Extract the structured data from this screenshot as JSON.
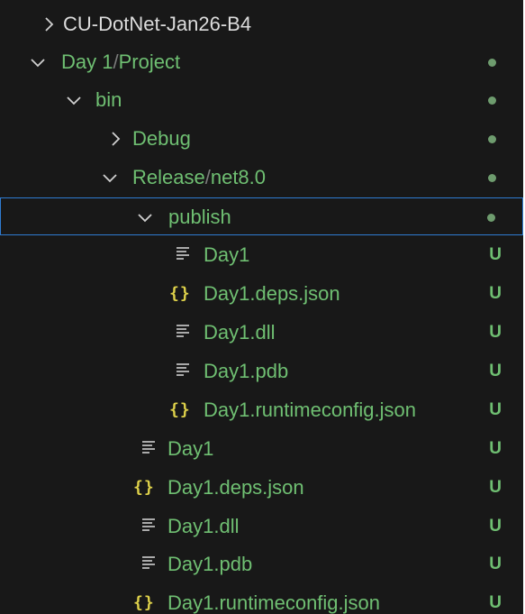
{
  "explorer": {
    "colors": {
      "background": "#181818",
      "green_label": "#6fbf72",
      "white_label": "#dcdcdc",
      "json_icon": "#dfd24a",
      "selection_border": "#2f7bd1"
    },
    "rows": [
      {
        "label": "CU-DotNet-Jan26-B4",
        "kind": "folder",
        "expanded": false,
        "color": "white",
        "status": "",
        "icon": "chevron-right-icon"
      },
      {
        "label_parts": [
          "Day 1",
          "Project"
        ],
        "kind": "folder",
        "expanded": true,
        "color": "green",
        "status": "modified-dot",
        "icon": "chevron-down-icon"
      },
      {
        "label": "bin",
        "kind": "folder",
        "expanded": true,
        "color": "green",
        "status": "modified-dot",
        "icon": "chevron-down-icon"
      },
      {
        "label": "Debug",
        "kind": "folder",
        "expanded": false,
        "color": "green",
        "status": "modified-dot",
        "icon": "chevron-right-icon"
      },
      {
        "label_parts": [
          "Release",
          "net8.0"
        ],
        "kind": "folder",
        "expanded": true,
        "color": "green",
        "status": "modified-dot",
        "icon": "chevron-down-icon"
      },
      {
        "label": "publish",
        "kind": "folder",
        "expanded": true,
        "color": "green",
        "status": "modified-dot",
        "selected": true,
        "icon": "chevron-down-icon"
      },
      {
        "label": "Day1",
        "kind": "file",
        "filetype": "text",
        "color": "green",
        "status": "U",
        "icon": "lines-file-icon"
      },
      {
        "label": "Day1.deps.json",
        "kind": "file",
        "filetype": "json",
        "color": "green",
        "status": "U",
        "icon": "json-braces-icon"
      },
      {
        "label": "Day1.dll",
        "kind": "file",
        "filetype": "text",
        "color": "green",
        "status": "U",
        "icon": "lines-file-icon"
      },
      {
        "label": "Day1.pdb",
        "kind": "file",
        "filetype": "text",
        "color": "green",
        "status": "U",
        "icon": "lines-file-icon"
      },
      {
        "label": "Day1.runtimeconfig.json",
        "kind": "file",
        "filetype": "json",
        "color": "green",
        "status": "U",
        "icon": "json-braces-icon"
      },
      {
        "label": "Day1",
        "kind": "file",
        "filetype": "text",
        "color": "green",
        "status": "U",
        "icon": "lines-file-icon"
      },
      {
        "label": "Day1.deps.json",
        "kind": "file",
        "filetype": "json",
        "color": "green",
        "status": "U",
        "icon": "json-braces-icon"
      },
      {
        "label": "Day1.dll",
        "kind": "file",
        "filetype": "text",
        "color": "green",
        "status": "U",
        "icon": "lines-file-icon"
      },
      {
        "label": "Day1.pdb",
        "kind": "file",
        "filetype": "text",
        "color": "green",
        "status": "U",
        "icon": "lines-file-icon"
      },
      {
        "label": "Day1.runtimeconfig.json",
        "kind": "file",
        "filetype": "json",
        "color": "green",
        "status": "U",
        "icon": "json-braces-icon"
      }
    ],
    "separator": "/",
    "json_glyph": "{}"
  }
}
